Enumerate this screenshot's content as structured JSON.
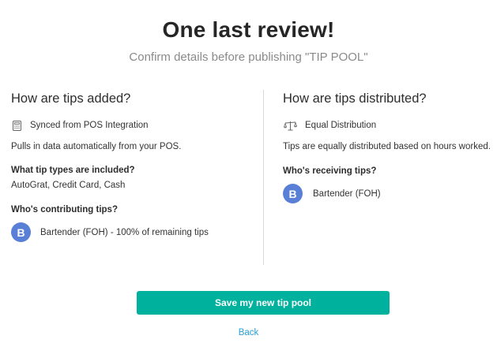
{
  "header": {
    "title": "One last review!",
    "subtitle": "Confirm details before publishing \"TIP POOL\""
  },
  "left": {
    "heading": "How are tips added?",
    "source": {
      "icon": "calculator-icon",
      "label": "Synced from POS Integration"
    },
    "description": "Pulls in data automatically from your POS.",
    "types_heading": "What tip types are included?",
    "types_value": "AutoGrat, Credit Card, Cash",
    "contrib_heading": "Who's contributing tips?",
    "contributor": {
      "initial": "B",
      "label": "Bartender (FOH) - 100% of remaining tips"
    }
  },
  "right": {
    "heading": "How are tips distributed?",
    "method": {
      "icon": "scale-icon",
      "label": "Equal Distribution"
    },
    "description": "Tips are equally distributed based on hours worked.",
    "recv_heading": "Who's receiving tips?",
    "receiver": {
      "initial": "B",
      "label": "Bartender (FOH)"
    }
  },
  "actions": {
    "save_label": "Save my new tip pool",
    "back_label": "Back"
  },
  "colors": {
    "accent": "#00b19d",
    "avatar": "#5a7fd6",
    "link": "#2a9fd6"
  }
}
